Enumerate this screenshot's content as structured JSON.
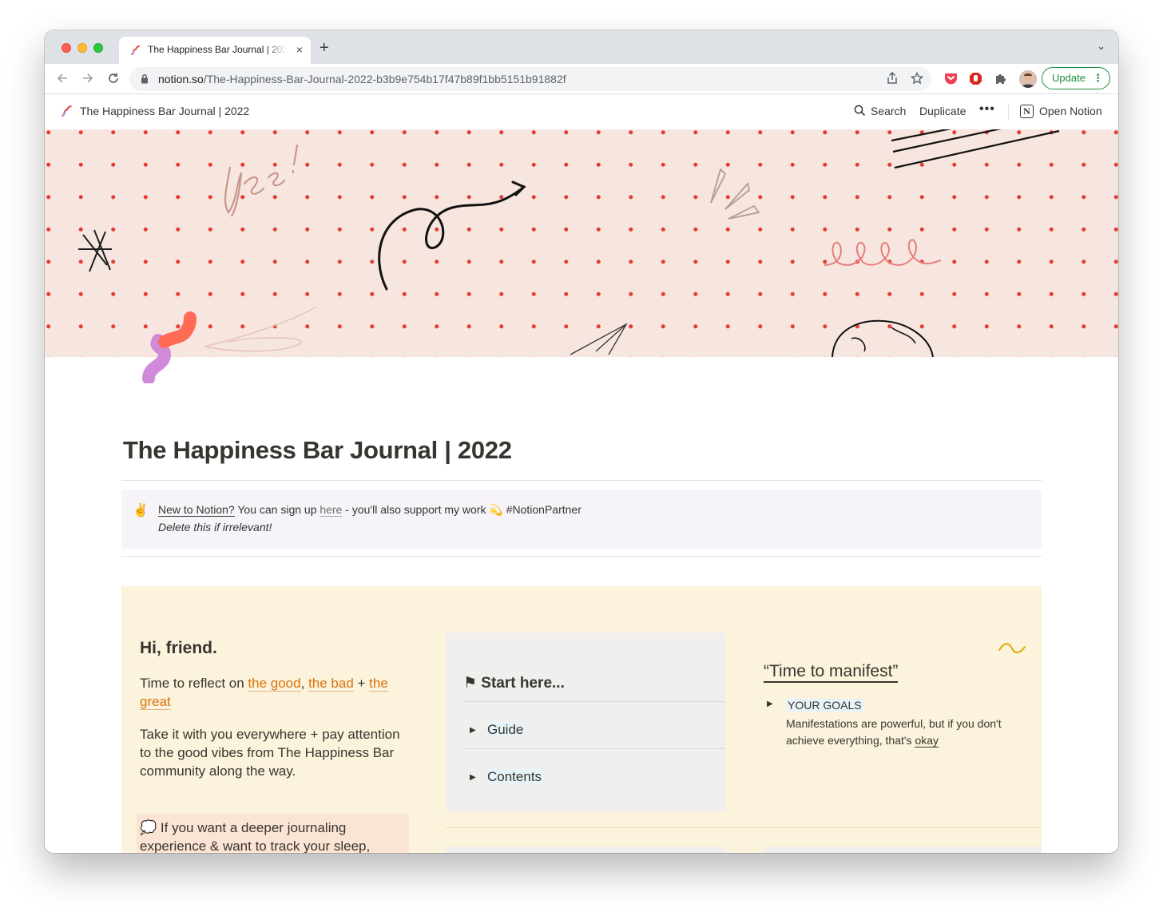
{
  "browser": {
    "tab_title": "The Happiness Bar Journal | 2022",
    "tab_close": "×",
    "new_tab": "+",
    "tab_menu": "⌄",
    "url_host": "notion.so",
    "url_path": "/The-Happiness-Bar-Journal-2022-b3b9e754b17f47b89f1bb5151b91882f",
    "update_label": "Update",
    "update_dots": "⋮"
  },
  "notion_bar": {
    "title": "The Happiness Bar Journal | 2022",
    "search": "Search",
    "duplicate": "Duplicate",
    "more": "•••",
    "open": "Open Notion",
    "logo": "N"
  },
  "page": {
    "title": "The Happiness Bar Journal | 2022",
    "callout": {
      "emoji": "✌️",
      "new_to_notion": "New to Notion?",
      "sign_up": " You can sign up ",
      "here": "here",
      "support": " - you'll also support my work ",
      "emoji2": "💫",
      "hashtag": "  #NotionPartner",
      "line2": "Delete this if irrelevant!"
    },
    "left_col": {
      "greeting": "Hi, friend.",
      "reflect_prefix": "Time to reflect on ",
      "good": "the good",
      "comma": ", ",
      "bad": "the bad",
      "plus": "  + ",
      "great": "the great",
      "body": "Take it with you everywhere + pay attention to the good vibes from The Happiness Bar community along the way.",
      "deeper_emoji": "💭",
      "deeper_line1": " If you want a deeper journaling",
      "deeper_line2": "experience &  want to track your sleep,"
    },
    "start_card": {
      "heading": "⚑ Start here...",
      "items": [
        "Guide",
        "Contents"
      ]
    },
    "right_col": {
      "heading": "“Time to manifest”",
      "goals_title": "YOUR GOALS",
      "goals_body_prefix": "Manifestations are powerful, but if you don't achieve everything, that's ",
      "goals_body_link": "okay"
    }
  },
  "colors": {
    "accent_orange": "#d9730d",
    "update_green": "#1e8e3e",
    "cover_bg": "#f7e6e0",
    "cover_dots": "#e53b35",
    "callout_bg": "#f6f3f9",
    "panel_bg": "#fbf3db"
  }
}
